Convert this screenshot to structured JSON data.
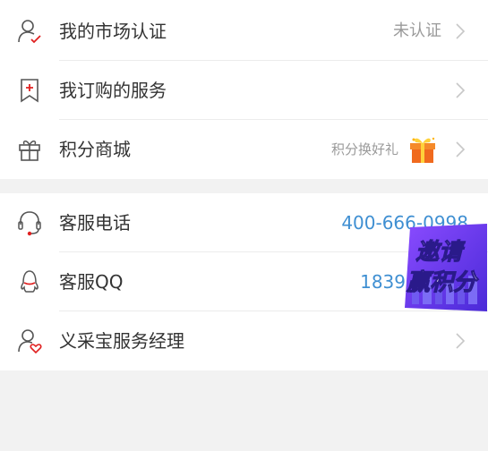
{
  "group1": {
    "items": [
      {
        "label": "我的市场认证",
        "value": "未认证",
        "icon": "user-check-icon"
      },
      {
        "label": "我订购的服务",
        "value": "",
        "icon": "bookmark-plus-icon"
      },
      {
        "label": "积分商城",
        "value": "积分换好礼",
        "icon": "gift-icon"
      }
    ]
  },
  "group2": {
    "items": [
      {
        "label": "客服电话",
        "value": "400-666-0998",
        "icon": "headset-icon"
      },
      {
        "label": "客服QQ",
        "value": "1839",
        "icon": "qq-icon"
      },
      {
        "label": "义采宝服务经理",
        "value": "",
        "icon": "user-heart-icon"
      }
    ]
  },
  "badge": {
    "line1": "邀请",
    "line2": "赢积分"
  },
  "colors": {
    "accent_red": "#e02020",
    "link_blue": "#3f8fd2",
    "icon_gray": "#555555",
    "chevron": "#c7c7c7"
  }
}
